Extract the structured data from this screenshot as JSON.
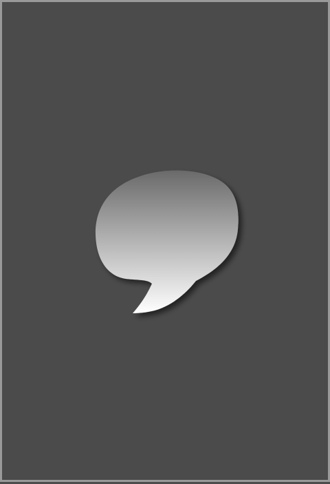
{
  "screen": {
    "background_color": "#4b4b4b",
    "border_color": "#9a9a9a"
  },
  "icon": {
    "name": "speech-bubble-icon",
    "gradient_top": "#6a6a6a",
    "gradient_bottom": "#ffffff"
  }
}
